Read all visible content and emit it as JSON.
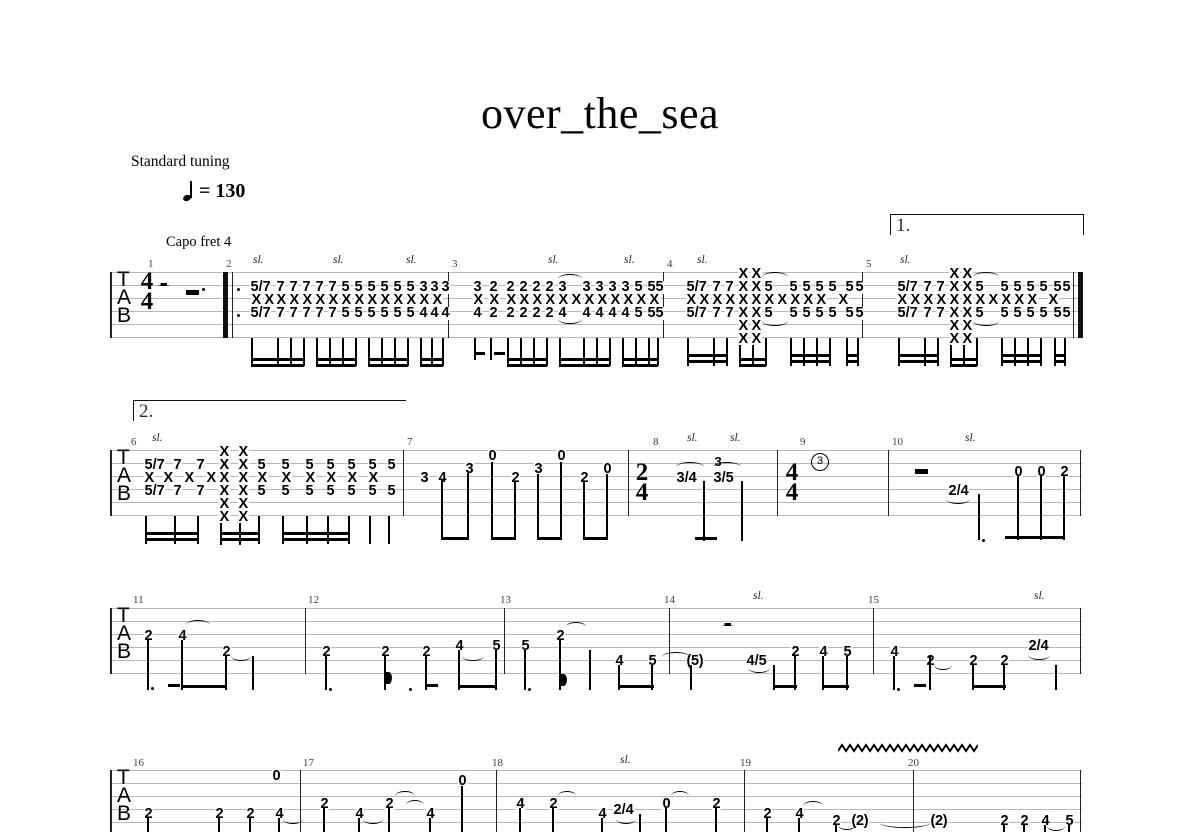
{
  "document": {
    "title": "over_the_sea",
    "tuning": "Standard tuning",
    "tempo_note": "quarter-note",
    "tempo_text": "= 130",
    "capo": "Capo fret 4",
    "clef": {
      "t": "T",
      "a": "A",
      "b": "B"
    },
    "time_signatures": [
      {
        "measure": 1,
        "numerator": "4",
        "denominator": "4"
      },
      {
        "measure": 8,
        "numerator": "2",
        "denominator": "4"
      },
      {
        "measure": 9,
        "numerator": "4",
        "denominator": "4"
      }
    ],
    "voltas": [
      {
        "label": "1.",
        "system": 1
      },
      {
        "label": "2.",
        "system": 2
      }
    ],
    "articulations": {
      "slide": "sl.",
      "string_indicator": "3"
    }
  },
  "systems": [
    {
      "index": 1,
      "measure_numbers": [
        "1",
        "2",
        "3",
        "4",
        "5"
      ],
      "slide_marks": [
        "sl.",
        "sl.",
        "sl.",
        "sl.",
        "sl.",
        "sl.",
        "sl."
      ],
      "measures": [
        {
          "number": "1",
          "content": "rest",
          "rests": [
            "quarter-rest",
            "dotted-half-rest"
          ]
        },
        {
          "number": "2",
          "rows": {
            "string1": [
              "5/7",
              "7",
              "7",
              "7",
              "7",
              "7",
              "5",
              "5",
              "5",
              "5",
              "5",
              "5",
              "3",
              "3",
              "3"
            ],
            "string2": [
              "X",
              "X",
              "X",
              "X",
              "X",
              "X",
              "X",
              "X",
              "X",
              "X",
              "X",
              "X",
              "X",
              "X",
              "X"
            ],
            "string3": [
              "5/7",
              "7",
              "7",
              "7",
              "7",
              "7",
              "5",
              "5",
              "5",
              "5",
              "5",
              "5",
              "4",
              "4",
              "4"
            ]
          }
        },
        {
          "number": "3",
          "rows": {
            "string1": [
              "3",
              "2",
              "2",
              "2",
              "2",
              "2",
              "3",
              "3",
              "3",
              "3",
              "3",
              "5",
              "5",
              "5"
            ],
            "string2": [
              "X",
              "X",
              "X",
              "X",
              "X",
              "X",
              "X",
              "X",
              "X",
              "X",
              "X",
              "X",
              "X",
              "X"
            ],
            "string3": [
              "4",
              "2",
              "2",
              "2",
              "2",
              "2",
              "4",
              "4",
              "4",
              "4",
              "4",
              "5",
              "5",
              "5"
            ]
          }
        },
        {
          "number": "4",
          "rows": {
            "string1": [
              "5/7",
              "7",
              "7",
              "X",
              "X",
              "5",
              "5",
              "5",
              "5",
              "5",
              "5",
              "5"
            ],
            "string2": [
              "X",
              "X",
              "X",
              "X",
              "X",
              "X",
              "X",
              "X",
              "X",
              "X",
              "X",
              "X"
            ],
            "string3": [
              "5/7",
              "7",
              "7",
              "X",
              "X",
              "5",
              "5",
              "5",
              "5",
              "5",
              "5",
              "5"
            ],
            "muted_extra_top": [
              "X",
              "X"
            ],
            "muted_extra_bottom": [
              "X",
              "X",
              "X",
              "X"
            ]
          }
        },
        {
          "number": "5",
          "rows": {
            "string1": [
              "5/7",
              "7",
              "7",
              "X",
              "X",
              "5",
              "5",
              "5",
              "5",
              "5",
              "5",
              "5"
            ],
            "string2": [
              "X",
              "X",
              "X",
              "X",
              "X",
              "X",
              "X",
              "X",
              "X",
              "X",
              "X",
              "X"
            ],
            "string3": [
              "5/7",
              "7",
              "7",
              "X",
              "X",
              "5",
              "5",
              "5",
              "5",
              "5",
              "5",
              "5"
            ],
            "muted_extra_top": [
              "X",
              "X"
            ],
            "muted_extra_bottom": [
              "X",
              "X",
              "X",
              "X"
            ]
          }
        }
      ]
    },
    {
      "index": 2,
      "measure_numbers": [
        "6",
        "7",
        "8",
        "9",
        "10"
      ],
      "measures": [
        {
          "number": "6",
          "rows": {
            "string1": [
              "5/7",
              "7",
              "7",
              "X",
              "X",
              "5",
              "5",
              "5",
              "5",
              "5",
              "5",
              "5"
            ],
            "string2": [
              "X",
              "X",
              "X",
              "X",
              "X",
              "X",
              "X",
              "X",
              "X",
              "X",
              "X",
              "X"
            ],
            "string3": [
              "5/7",
              "7",
              "7",
              "X",
              "X",
              "5",
              "5",
              "5",
              "5",
              "5",
              "5",
              "5"
            ],
            "muted_extra_top": [
              "X",
              "X"
            ],
            "muted_extra_bottom": [
              "X",
              "X",
              "X",
              "X"
            ]
          }
        },
        {
          "number": "7",
          "notes": [
            "3",
            "4",
            "3",
            "0",
            "2",
            "3",
            "0",
            "2",
            "0"
          ]
        },
        {
          "number": "8",
          "time_signature": "2/4",
          "notes": [
            "3/4",
            "3",
            "3/5"
          ]
        },
        {
          "number": "9",
          "time_signature": "4/4",
          "string_indicator": "3"
        },
        {
          "number": "10",
          "notes": [
            "2/4",
            "0",
            "0",
            "2"
          ],
          "rests": [
            "half-rest"
          ]
        }
      ]
    },
    {
      "index": 3,
      "measure_numbers": [
        "11",
        "12",
        "13",
        "14",
        "15"
      ],
      "measures": [
        {
          "number": "11",
          "notes": [
            "2",
            "4",
            "2"
          ]
        },
        {
          "number": "12",
          "notes": [
            "2",
            "2",
            "2",
            "4",
            "5"
          ]
        },
        {
          "number": "13",
          "notes": [
            "5",
            "2",
            "4",
            "5",
            "(5)"
          ]
        },
        {
          "number": "14",
          "notes": [
            "4/5",
            "2",
            "4",
            "5"
          ],
          "rests": [
            "quarter-rest"
          ]
        },
        {
          "number": "15",
          "notes": [
            "4",
            "2",
            "2",
            "2",
            "2/4"
          ]
        }
      ]
    },
    {
      "index": 4,
      "measure_numbers": [
        "16",
        "17",
        "18",
        "19",
        "20"
      ],
      "measures": [
        {
          "number": "16",
          "notes": [
            "2",
            "2",
            "2",
            "4",
            "0"
          ]
        },
        {
          "number": "17",
          "notes": [
            "2",
            "4",
            "2",
            "4",
            "0"
          ]
        },
        {
          "number": "18",
          "notes": [
            "4",
            "2",
            "4",
            "2/4",
            "0",
            "2"
          ]
        },
        {
          "number": "19",
          "notes": [
            "2",
            "4",
            "2",
            "(2)"
          ]
        },
        {
          "number": "20",
          "notes": [
            "(2)",
            "2",
            "2",
            "4",
            "5"
          ],
          "vibrato": true
        }
      ]
    }
  ]
}
